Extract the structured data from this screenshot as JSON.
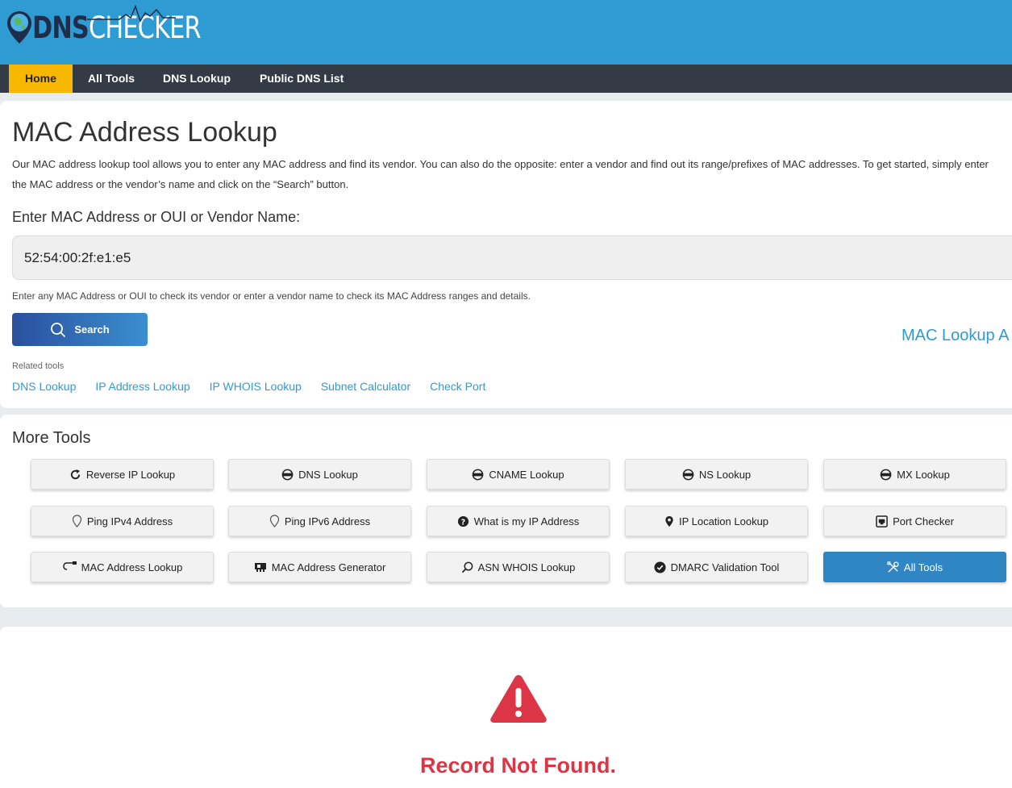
{
  "logo": {
    "part1": "DNS",
    "part2": "CHECKER"
  },
  "nav": {
    "items": [
      "Home",
      "All Tools",
      "DNS Lookup",
      "Public DNS List"
    ]
  },
  "page": {
    "title": "MAC Address Lookup",
    "description": "Our MAC address lookup tool allows you to enter any MAC address and find its vendor. You can also do the opposite: enter a vendor and find out its range/prefixes of MAC addresses. To get started, simply enter the MAC address or the vendor’s name and click on the “Search” button.",
    "input_label": "Enter MAC Address or OUI or Vendor Name:",
    "input_value": "52:54:00:2f:e1:e5",
    "hint": "Enter any MAC Address or OUI to check its vendor or enter a vendor name to check its MAC Address ranges and details.",
    "search_label": "Search",
    "api_link": "MAC Lookup A",
    "related_label": "Related tools",
    "related_links": [
      "DNS Lookup",
      "IP Address Lookup",
      "IP WHOIS Lookup",
      "Subnet Calculator",
      "Check Port"
    ]
  },
  "more_tools": {
    "title": "More Tools",
    "tools": [
      {
        "label": "Reverse IP Lookup",
        "icon": "refresh-icon"
      },
      {
        "label": "DNS Lookup",
        "icon": "dns-globe-icon"
      },
      {
        "label": "CNAME Lookup",
        "icon": "dns-globe-icon"
      },
      {
        "label": "NS Lookup",
        "icon": "dns-globe-icon"
      },
      {
        "label": "MX Lookup",
        "icon": "dns-globe-icon"
      },
      {
        "label": "Ping IPv4 Address",
        "icon": "ip-pin-icon"
      },
      {
        "label": "Ping IPv6 Address",
        "icon": "ip-pin-icon"
      },
      {
        "label": "What is my IP Address",
        "icon": "question-circle-icon"
      },
      {
        "label": "IP Location Lookup",
        "icon": "map-pin-icon"
      },
      {
        "label": "Port Checker",
        "icon": "port-icon"
      },
      {
        "label": "MAC Address Lookup",
        "icon": "cable-icon"
      },
      {
        "label": "MAC Address Generator",
        "icon": "network-card-icon"
      },
      {
        "label": "ASN WHOIS Lookup",
        "icon": "search-asn-icon"
      },
      {
        "label": "DMARC Validation Tool",
        "icon": "check-badge-icon"
      },
      {
        "label": "All Tools",
        "icon": "tools-icon"
      }
    ]
  },
  "result": {
    "message": "Record Not Found."
  },
  "colors": {
    "header": "#2f9bd3",
    "nav": "#353b45",
    "active_tab": "#f8b800",
    "link": "#2f9bd3",
    "error": "#dc3545"
  }
}
